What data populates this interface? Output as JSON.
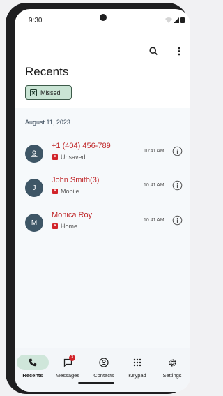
{
  "status": {
    "time": "9:30"
  },
  "header": {
    "title": "Recents",
    "filter_chip": "Missed"
  },
  "section": {
    "date": "August 11, 2023"
  },
  "calls": [
    {
      "avatar": "person-icon",
      "name": "+1 (404) 456-789",
      "type": "Unsaved",
      "time": "10:41 AM"
    },
    {
      "avatar": "J",
      "name": "John Smith(3)",
      "type": "Mobile",
      "time": "10:41 AM"
    },
    {
      "avatar": "M",
      "name": "Monica Roy",
      "type": "Home",
      "time": "10:41 AM"
    }
  ],
  "nav": {
    "items": [
      {
        "label": "Recents",
        "icon": "phone-icon",
        "active": true
      },
      {
        "label": "Messages",
        "icon": "message-icon",
        "badge": "3"
      },
      {
        "label": "Contacts",
        "icon": "contacts-icon"
      },
      {
        "label": "Keypad",
        "icon": "keypad-icon"
      },
      {
        "label": "Settings",
        "icon": "gear-icon"
      }
    ]
  },
  "colors": {
    "accent": "#cfe6da",
    "missed": "#c0282a",
    "avatar": "#3e5666"
  }
}
